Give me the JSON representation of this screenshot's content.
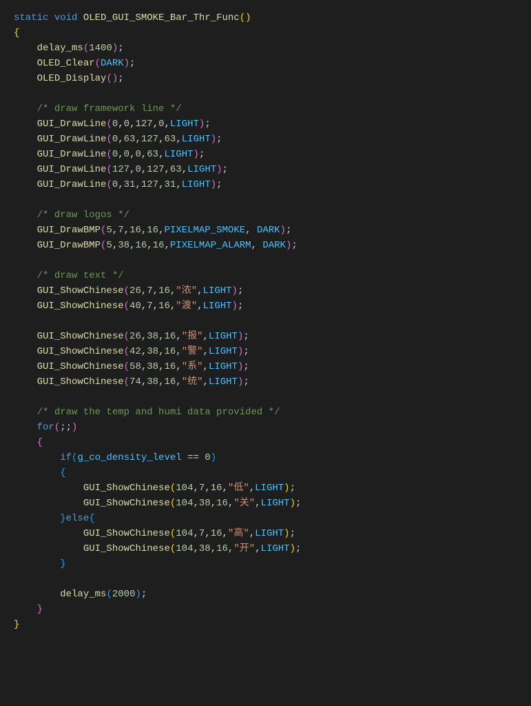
{
  "line1_static": "static",
  "line1_void": "void",
  "line1_fnname": "OLED_GUI_SMOKE_Bar_Thr_Func",
  "line2_brace": "{",
  "line3_fn": "delay_ms",
  "line3_num": "1400",
  "line4_fn": "OLED_Clear",
  "line4_const": "DARK",
  "line5_fn": "OLED_Display",
  "comment_framework": "/* draw framework line */",
  "gui_drawline": "GUI_DrawLine",
  "light": "LIGHT",
  "dark": "DARK",
  "dl1_args": "0,0,127,0,",
  "dl2_args": "0,63,127,63,",
  "dl3_args": "0,0,0,63,",
  "dl4_args": "127,0,127,63,",
  "dl5_args": "0,31,127,31,",
  "comment_logos": "/* draw logos */",
  "gui_drawbmp": "GUI_DrawBMP",
  "bmp1_args": "5,7,16,16,",
  "pixelmap_smoke": "PIXELMAP_SMOKE",
  "bmp2_args": "5,38,16,16,",
  "pixelmap_alarm": "PIXELMAP_ALARM",
  "comment_text": "/* draw text */",
  "gui_showchinese": "GUI_ShowChinese",
  "sc1_args": "26,7,16,",
  "sc1_str": "\"浓\"",
  "sc2_args": "40,7,16,",
  "sc2_str": "\"渡\"",
  "sc3_args": "26,38,16,",
  "sc3_str": "\"报\"",
  "sc4_args": "42,38,16,",
  "sc4_str": "\"警\"",
  "sc5_args": "58,38,16,",
  "sc5_str": "\"系\"",
  "sc6_args": "74,38,16,",
  "sc6_str": "\"统\"",
  "comment_temp": "/* draw the temp and humi data provided */",
  "for_kw": "for",
  "if_kw": "if",
  "else_kw": "else",
  "g_co": "g_co_density_level",
  "eq_zero": "== 0",
  "sc7_args": "104,7,16,",
  "sc7_str": "\"低\"",
  "sc8_args": "104,38,16,",
  "sc8_str": "\"关\"",
  "sc9_args": "104,7,16,",
  "sc9_str": "\"高\"",
  "sc10_args": "104,38,16,",
  "sc10_str": "\"开\"",
  "delay2": "2000",
  "zero": "0"
}
